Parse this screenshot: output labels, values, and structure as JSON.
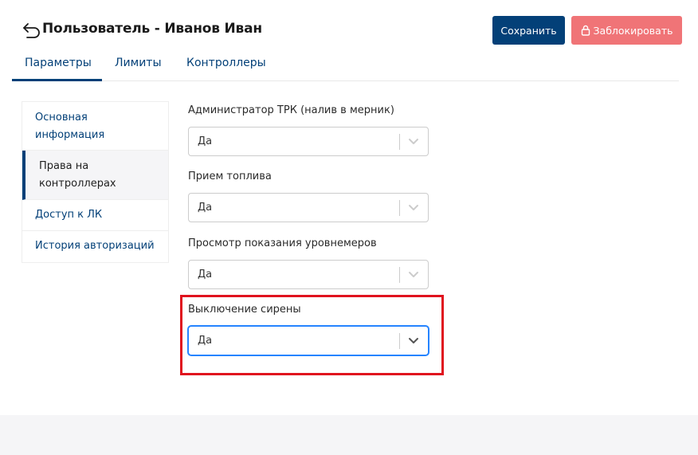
{
  "header": {
    "title": "Пользователь - Иванов Иван",
    "save_label": "Сохранить",
    "block_label": "Заблокировать"
  },
  "tabs": [
    {
      "label": "Параметры",
      "active": true
    },
    {
      "label": "Лимиты",
      "active": false
    },
    {
      "label": "Контроллеры",
      "active": false
    }
  ],
  "sidebar": {
    "items": [
      {
        "label": "Основная информация",
        "active": false
      },
      {
        "label": "Права на контроллерах",
        "active": true
      },
      {
        "label": "Доступ к ЛК",
        "active": false
      },
      {
        "label": "История авторизаций",
        "active": false
      }
    ]
  },
  "fields": [
    {
      "label": "Администратор ТРК (налив в мерник)",
      "value": "Да"
    },
    {
      "label": "Прием топлива",
      "value": "Да"
    },
    {
      "label": "Просмотр показания уровнемеров",
      "value": "Да"
    },
    {
      "label": "Выключение сирены",
      "value": "Да",
      "focused": true
    }
  ],
  "colors": {
    "primary": "#034078",
    "danger": "#f07477",
    "highlight": "#e0121e",
    "focus": "#2684ff"
  },
  "icons": {
    "back": "back-arrow-icon",
    "lock": "lock-icon",
    "chevron": "chevron-down-icon"
  }
}
